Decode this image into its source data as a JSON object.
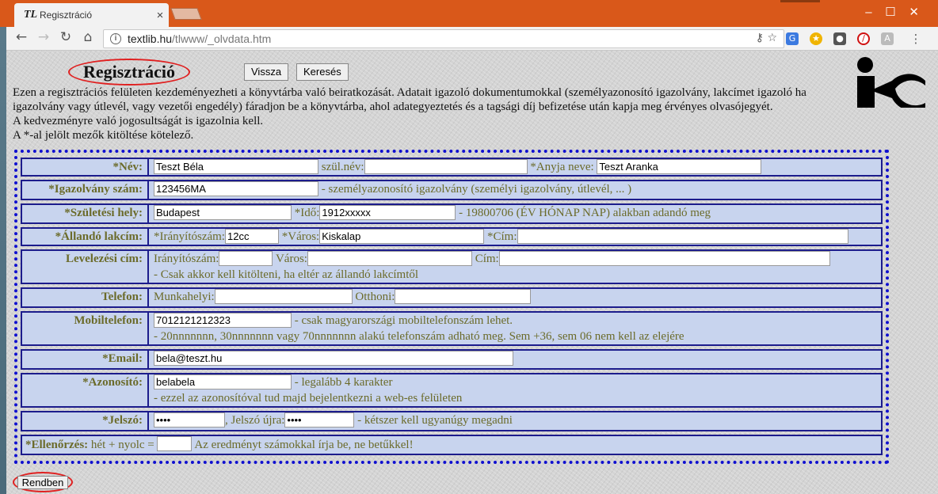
{
  "browser": {
    "tab_title": "Regisztráció",
    "tab_icon": "TL",
    "url_host": "textlib.hu",
    "url_path": "/tlwww/_olvdata.htm"
  },
  "page": {
    "title": "Regisztráció",
    "back_button": "Vissza",
    "search_button": "Keresés",
    "intro_lines": [
      "Ezen a regisztrációs felületen kezdeményezheti a könyvtárba való beiratkozását. Adatait igazoló dokumentumokkal (személyazonosító igazolvány, lakcímet igazoló ha",
      "igazolvány vagy útlevél, vagy vezetői engedély) fáradjon be a könyvtárba, ahol adategyeztetés és a tagsági díj befizetése után kapja meg érvényes olvasójegyét.",
      "A kedvezményre való jogosultságát is igazolnia kell.",
      "A *-al jelölt mezők kitöltése kötelező."
    ]
  },
  "form": {
    "name": {
      "label": "*Név:",
      "value": "Teszt Béla",
      "birth_name_label": "szül.név:",
      "birth_name_value": "",
      "mother_label": "*Anyja neve:",
      "mother_value": "Teszt Aranka"
    },
    "id_card": {
      "label": "*Igazolvány szám:",
      "value": "123456MA",
      "hint": "- személyazonosító igazolvány (személyi igazolvány, útlevél, ... )"
    },
    "birth": {
      "label": "*Születési hely:",
      "place_value": "Budapest",
      "date_label": "*Idő:",
      "date_value": "1912xxxxx",
      "hint": "- 19800706 (ÉV HÓNAP NAP) alakban adandó meg"
    },
    "address": {
      "label": "*Állandó lakcím:",
      "zip_label": "*Irányítószám:",
      "zip_value": "12cc",
      "city_label": "*Város:",
      "city_value": "Kiskalap",
      "street_label": "*Cím:",
      "street_value": ""
    },
    "mailing": {
      "label": "Levelezési cím:",
      "zip_label": "Irányítószám:",
      "city_label": "Város:",
      "street_label": "Cím:",
      "hint": "- Csak akkor kell kitölteni, ha eltér az állandó lakcímtől"
    },
    "phone": {
      "label": "Telefon:",
      "work_label": "Munkahelyi:",
      "home_label": "Otthoni:"
    },
    "mobile": {
      "label": "Mobiltelefon:",
      "value": "7012121212323",
      "hint1": "- csak magyarországi mobiltelefonszám lehet.",
      "hint2": "- 20nnnnnnn, 30nnnnnnn vagy 70nnnnnnn alakú telefonszám adható meg. Sem +36, sem 06 nem kell az elejére"
    },
    "email": {
      "label": "*Email:",
      "value": "bela@teszt.hu"
    },
    "login": {
      "label": "*Azonosító:",
      "value": "belabela",
      "hint1": "- legalább 4 karakter",
      "hint2": "- ezzel az azonosítóval tud majd bejelentkezni a web-es felületen"
    },
    "password": {
      "label": "*Jelszó:",
      "value": "••••",
      "again_label": ", Jelszó újra:",
      "again_value": "••••",
      "hint": "- kétszer kell ugyanúgy megadni"
    },
    "captcha": {
      "label": "*Ellenőrzés:",
      "question": "hét + nyolc =",
      "hint": "Az eredményt számokkal írja be, ne betűkkel!"
    },
    "submit": "Rendben"
  }
}
